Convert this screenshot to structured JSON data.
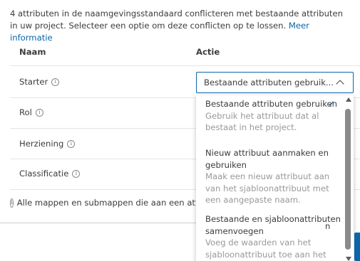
{
  "intro": {
    "text": "4 attributen in de naamgevingsstandaard conflicteren met bestaande attributen in uw project. Selecteer een optie om deze conflicten op te lossen.",
    "link": "Meer informatie"
  },
  "table": {
    "headers": {
      "name": "Naam",
      "action": "Actie"
    },
    "rows": [
      {
        "label": "Starter"
      },
      {
        "label": "Rol"
      },
      {
        "label": "Herziening"
      },
      {
        "label": "Classificatie"
      }
    ]
  },
  "select": {
    "value": "Bestaande attributen gebruik..."
  },
  "dropdown": {
    "options": [
      {
        "title": "Bestaande attributen gebruiken",
        "desc": "Gebruik het attribuut dat al bestaat in het project.",
        "selected": true
      },
      {
        "title": "Nieuw attribuut aanmaken en gebruiken",
        "desc": "Maak een nieuw attribuut aan van het sjabloonattribuut met een aangepaste naam.",
        "selected": false
      },
      {
        "title": "Bestaande en sjabloonattributen samenvoegen",
        "desc": "Voeg de waarden van het sjabloonattribuut toe aan het",
        "selected": false
      }
    ]
  },
  "footer": {
    "note": "Alle mappen en submappen die aan een attrib",
    "stray": "n"
  },
  "icons": {
    "info": "info-icon",
    "check": "checkmark-icon",
    "chevron": "chevron-up-icon"
  },
  "colors": {
    "accent": "#0a66a8",
    "text": "#3c3c3c",
    "muted": "#999999"
  }
}
